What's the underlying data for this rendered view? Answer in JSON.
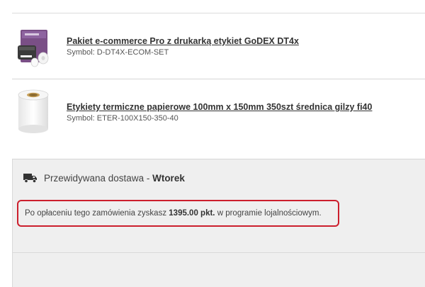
{
  "products": [
    {
      "name": "Pakiet e-commerce Pro z drukarką etykiet GoDEX DT4x",
      "symbol": "Symbol: D-DT4X-ECOM-SET"
    },
    {
      "name": "Etykiety termiczne papierowe 100mm x 150mm 350szt średnica gilzy fi40",
      "symbol": "Symbol: ETER-100X150-350-40"
    }
  ],
  "delivery": {
    "label": "Przewidywana dostawa - ",
    "day": "Wtorek"
  },
  "loyalty": {
    "prefix": "Po opłaceniu tego zamówienia zyskasz ",
    "points": "1395.00 pkt.",
    "suffix": " w programie lojalnościowym."
  },
  "colors": {
    "highlight_border": "#cc1f2d",
    "summary_background": "#efefef"
  }
}
